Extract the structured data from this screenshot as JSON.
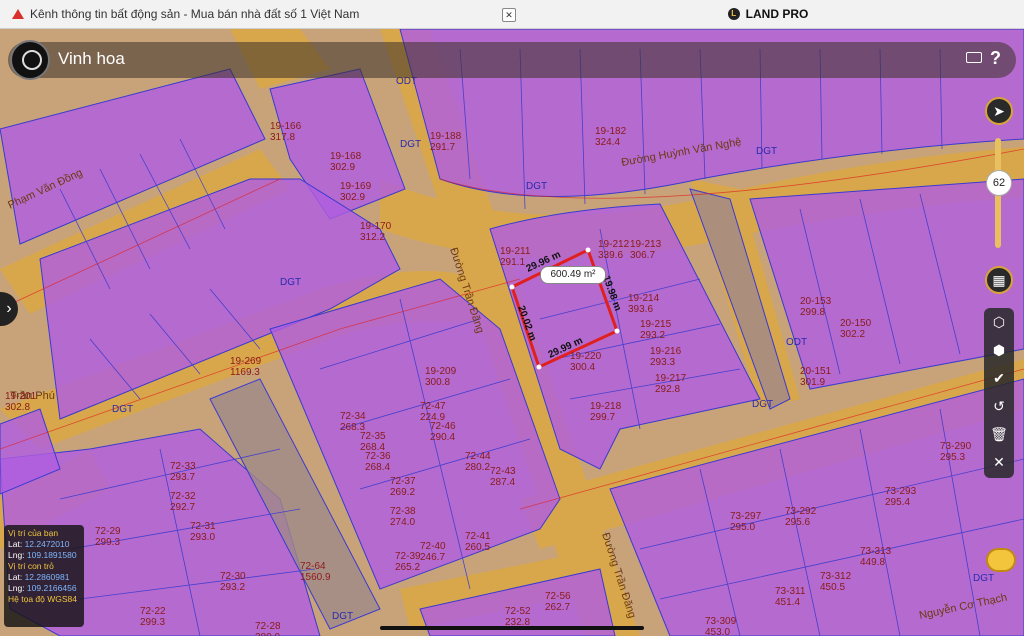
{
  "tabs": [
    {
      "label": "Kênh thông tin bất động sản - Mua bán nhà đất số 1 Việt Nam",
      "active": false
    },
    {
      "label": "LAND PRO",
      "active": true
    }
  ],
  "search": {
    "value": "Vinh hoa"
  },
  "zoom_level": "62",
  "map_labels": {
    "streets": [
      "Đường Trần Đăng",
      "Đường Huỳnh Văn Nghệ",
      "Phạm Văn Đồng",
      "Trần Phú",
      "Đường Trần Đăng",
      "Nguyễn Cơ Thạch"
    ],
    "land_types": [
      "ODT",
      "DGT",
      "DGT",
      "DGT",
      "DGT",
      "DGT",
      "ODT",
      "DGT",
      "DGT",
      "DGT"
    ],
    "parcels": [
      {
        "id": "19-166",
        "area": "317.8"
      },
      {
        "id": "19-168",
        "area": "302.9"
      },
      {
        "id": "19-169",
        "area": "302.9"
      },
      {
        "id": "19-170",
        "area": "312.2"
      },
      {
        "id": "19-188",
        "area": "291.7"
      },
      {
        "id": "19-182",
        "area": "324.4"
      },
      {
        "id": "19-211",
        "area": "291.1"
      },
      {
        "id": "19-212",
        "area": "339.6"
      },
      {
        "id": "19-213",
        "area": "306.7"
      },
      {
        "id": "19-214",
        "area": "393.6"
      },
      {
        "id": "19-215",
        "area": "293.2"
      },
      {
        "id": "19-216",
        "area": "293.3"
      },
      {
        "id": "19-217",
        "area": "292.8"
      },
      {
        "id": "19-218",
        "area": "299.7"
      },
      {
        "id": "19-220",
        "area": "300.4"
      },
      {
        "id": "19-209",
        "area": "300.8"
      },
      {
        "id": "19-269",
        "area": "1169.3"
      },
      {
        "id": "19-201",
        "area": "302.8"
      },
      {
        "id": "20-153",
        "area": "299.8"
      },
      {
        "id": "20-150",
        "area": "302.2"
      },
      {
        "id": "20-151",
        "area": "301.9"
      },
      {
        "id": "72-64",
        "area": "1560.9"
      },
      {
        "id": "72-34",
        "area": "268.3"
      },
      {
        "id": "72-35",
        "area": "268.4"
      },
      {
        "id": "72-36",
        "area": "268.4"
      },
      {
        "id": "72-37",
        "area": "269.2"
      },
      {
        "id": "72-38",
        "area": "274.0"
      },
      {
        "id": "72-39",
        "area": "265.2"
      },
      {
        "id": "72-40",
        "area": "246.7"
      },
      {
        "id": "72-41",
        "area": "260.5"
      },
      {
        "id": "72-43",
        "area": "287.4"
      },
      {
        "id": "72-44",
        "area": "280.2"
      },
      {
        "id": "72-46",
        "area": "290.4"
      },
      {
        "id": "72-47",
        "area": "224.9"
      },
      {
        "id": "72-29",
        "area": "299.3"
      },
      {
        "id": "72-30",
        "area": "293.2"
      },
      {
        "id": "72-31",
        "area": "293.0"
      },
      {
        "id": "72-32",
        "area": "292.7"
      },
      {
        "id": "72-33",
        "area": "293.7"
      },
      {
        "id": "72-28",
        "area": "280.0"
      },
      {
        "id": "72-22",
        "area": "299.3"
      },
      {
        "id": "72-52",
        "area": "232.8"
      },
      {
        "id": "72-56",
        "area": "262.7"
      },
      {
        "id": "73-297",
        "area": "295.0"
      },
      {
        "id": "73-312",
        "area": "450.5"
      },
      {
        "id": "73-313",
        "area": "449.8"
      },
      {
        "id": "73-311",
        "area": "451.4"
      },
      {
        "id": "73-309",
        "area": "453.0"
      },
      {
        "id": "73-292",
        "area": "295.6"
      },
      {
        "id": "73-293",
        "area": "295.4"
      },
      {
        "id": "73-290",
        "area": "295.3"
      }
    ]
  },
  "measurement": {
    "area": "600.49 m²",
    "edges": [
      "29.96 m",
      "19.98 m",
      "29.99 m",
      "20.02 m"
    ]
  },
  "info_box": {
    "your_location_title": "Vị trí của bạn",
    "lat_label": "Lat:",
    "lat_value": "12.2472010",
    "lng_label": "Lng:",
    "lng_value": "109.1891580",
    "pointer_title": "Vị trí con trỏ",
    "lat2_value": "12.2860981",
    "lng2_value": "109.2166456",
    "crs": "Hệ tọa độ WGS84"
  },
  "colors": {
    "parcel": "#b05ee0",
    "road": "#d9a84a",
    "selected": "#e0201e",
    "accent": "#e0b030"
  }
}
